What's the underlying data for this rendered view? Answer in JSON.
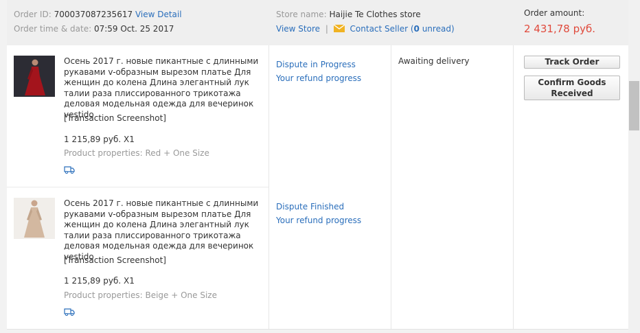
{
  "header": {
    "order_id_label": "Order ID:",
    "order_id_value": "700037087235617",
    "view_detail": "View Detail",
    "order_time_label": "Order time & date:",
    "order_time_value": "07:59 Oct. 25 2017",
    "store_name_label": "Store name:",
    "store_name_value": "Haijie Te Clothes store",
    "view_store": "View Store",
    "separator": "|",
    "contact_seller": "Contact Seller (",
    "unread_count": "0",
    "unread_suffix": " unread)",
    "order_amount_label": "Order amount:",
    "order_amount_value": "2 431,78 руб."
  },
  "items": [
    {
      "title": "Осень 2017 г. новые пикантные с длинными рукавами v-образным вырезом платье Для женщин до колена Длина элегантный лук талии раза плиссированного трикотажа деловая модельная одежда для вечеринок vestido",
      "transaction": "[Transaction Screenshot]",
      "price": "1 215,89 руб. X1",
      "properties": "Product properties: Red + One Size",
      "dispute_status": "Dispute in Progress",
      "refund_link": "Your refund progress",
      "thumb_color": "#a3141c"
    },
    {
      "title": "Осень 2017 г. новые пикантные с длинными рукавами v-образным вырезом платье Для женщин до колена Длина элегантный лук талии раза плиссированного трикотажа деловая модельная одежда для вечеринок vestido",
      "transaction": "[Transaction Screenshot]",
      "price": "1 215,89 руб. X1",
      "properties": "Product properties: Beige + One Size",
      "dispute_status": "Dispute Finished",
      "refund_link": "Your refund progress",
      "thumb_color": "#d3b8a0"
    }
  ],
  "order_status": "Awaiting delivery",
  "actions": {
    "track_order": "Track Order",
    "confirm_goods_line1": "Confirm Goods",
    "confirm_goods_line2": "Received"
  },
  "icons": {
    "truck": "truck-icon",
    "mail": "envelope-icon"
  },
  "colors": {
    "link": "#2a6ebb",
    "amount": "#e04a3c",
    "header_bg": "#efefef",
    "mail_icon": "#f0b323"
  }
}
